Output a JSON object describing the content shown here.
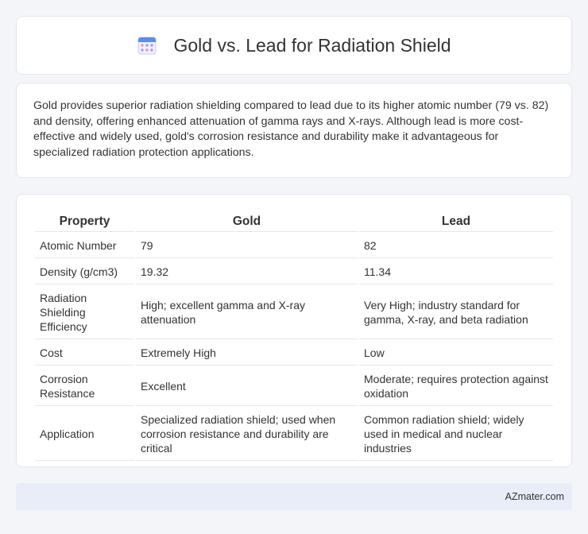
{
  "header": {
    "title": "Gold vs. Lead for Radiation Shield",
    "icon": "calendar-icon"
  },
  "summary": "Gold provides superior radiation shielding compared to lead due to its higher atomic number (79 vs. 82) and density, offering enhanced attenuation of gamma rays and X-rays. Although lead is more cost-effective and widely used, gold's corrosion resistance and durability make it advantageous for specialized radiation protection applications.",
  "table": {
    "headers": [
      "Property",
      "Gold",
      "Lead"
    ],
    "rows": [
      [
        "Atomic Number",
        "79",
        "82"
      ],
      [
        "Density (g/cm3)",
        "19.32",
        "11.34"
      ],
      [
        "Radiation Shielding Efficiency",
        "High; excellent gamma and X-ray attenuation",
        "Very High; industry standard for gamma, X-ray, and beta radiation"
      ],
      [
        "Cost",
        "Extremely High",
        "Low"
      ],
      [
        "Corrosion Resistance",
        "Excellent",
        "Moderate; requires protection against oxidation"
      ],
      [
        "Application",
        "Specialized radiation shield; used when corrosion resistance and durability are critical",
        "Common radiation shield; widely used in medical and nuclear industries"
      ]
    ]
  },
  "footer": {
    "brand": "AZmater.com"
  }
}
